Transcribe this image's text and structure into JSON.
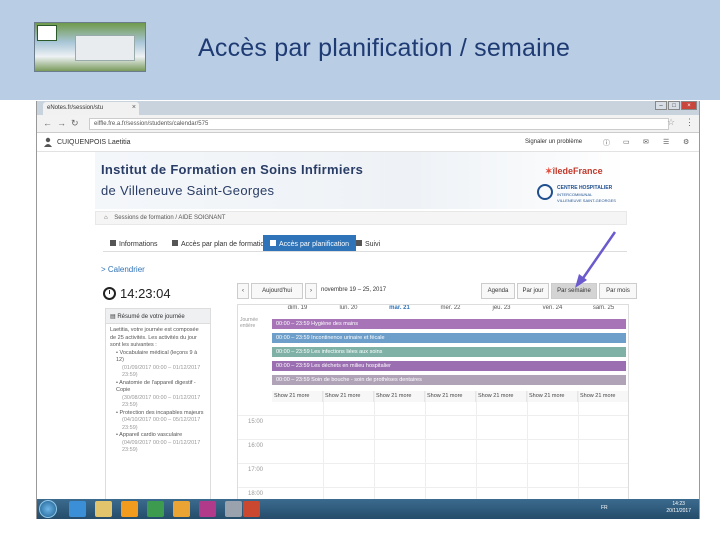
{
  "slide": {
    "title": "Accès par planification / semaine"
  },
  "browser": {
    "tab_title": "eNotes.fr/session/stu",
    "url": "eiffle.fre.a.fr/session/students/calendar/575"
  },
  "userbar": {
    "name": "CUIQUENPOIS Laetitia",
    "report": "Signaler un problème"
  },
  "banner": {
    "line1": "Institut de Formation en Soins Infirmiers",
    "line2": "de Villeneuve Saint-Georges",
    "region": "îledeFrance",
    "chi_line1": "CENTRE HOSPITALIER",
    "chi_line2": "INTERCOMMUNAL",
    "chi_line3": "VILLENEUVE SAINT-GEORGES"
  },
  "breadcrumb": {
    "items": [
      "Sessions de formation",
      "AIDE SOIGNANT"
    ]
  },
  "tabs": [
    {
      "label": "Informations"
    },
    {
      "label": "Accès par plan de formation"
    },
    {
      "label": "Accès par planification"
    },
    {
      "label": "Suivi"
    }
  ],
  "calendar_link": "Calendrier",
  "clock": "14:23:04",
  "toolbar": {
    "today": "Aujourd'hui",
    "prev": "‹",
    "next": "›",
    "range": "novembre 19 – 25, 2017",
    "views": [
      "Agenda",
      "Par jour",
      "Par semaine",
      "Par mois"
    ]
  },
  "summary": {
    "title": "Résumé de votre journée",
    "intro": "Laetitia, votre journée est composée de 25 activités. Les activités du jour sont les suivantes :",
    "items": [
      {
        "text": "Vocabulaire médical (leçons 9 à 12)",
        "dates": "(01/09/2017 00:00 – 01/12/2017 23:59)"
      },
      {
        "text": "Anatomie de l'appareil digestif - Copie",
        "dates": "(30/08/2017 00:00 – 01/12/2017 23:59)"
      },
      {
        "text": "Protection des incapables majeurs",
        "dates": "(04/10/2017 00:00 – 05/12/2017 23:59)"
      },
      {
        "text": "Appareil cardio vasculaire",
        "dates": "(04/09/2017 00:00 – 01/12/2017 23:59)"
      }
    ]
  },
  "calendar": {
    "days": [
      "dim. 19",
      "lun. 20",
      "mar. 21",
      "mer. 22",
      "jeu. 23",
      "ven. 24",
      "sam. 25"
    ],
    "allday_label": "Journée entière",
    "events": [
      {
        "label": "00:00 – 23:59  Hygiène des mains",
        "color": "#a774b8"
      },
      {
        "label": "00:00 – 23:59  Incontinence urinaire et fécale",
        "color": "#6d9fca"
      },
      {
        "label": "00:00 – 23:59  Les infections liées aux soins",
        "color": "#7fb1a6"
      },
      {
        "label": "00:00 – 23:59  Les déchets en milieu hospitalier",
        "color": "#9b6db1"
      },
      {
        "label": "00:00 – 23:59  Soin de bouche - soin de prothèses dentaires",
        "color": "#b0a3b8"
      }
    ],
    "show_more": "Show 21 more",
    "hours": [
      "15:00",
      "16:00",
      "17:00",
      "18:00"
    ]
  },
  "taskbar": {
    "lang": "FR",
    "time": "14:23",
    "date": "20/11/2017"
  }
}
